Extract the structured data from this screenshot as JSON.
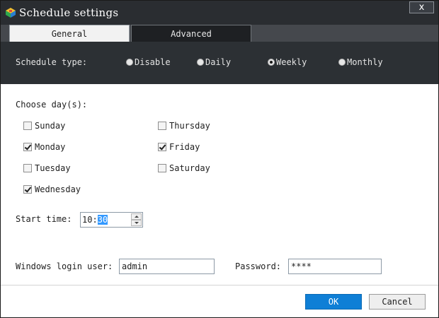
{
  "window": {
    "title": "Schedule settings",
    "close_label": "x"
  },
  "tabs": [
    {
      "label": "General",
      "active": true
    },
    {
      "label": "Advanced",
      "active": false
    }
  ],
  "schedule_type": {
    "label": "Schedule type:",
    "options": [
      {
        "label": "Disable",
        "selected": false
      },
      {
        "label": "Daily",
        "selected": false
      },
      {
        "label": "Weekly",
        "selected": true
      },
      {
        "label": "Monthly",
        "selected": false
      }
    ]
  },
  "days": {
    "label": "Choose day(s):",
    "items": [
      {
        "label": "Sunday",
        "checked": false
      },
      {
        "label": "Monday",
        "checked": true
      },
      {
        "label": "Tuesday",
        "checked": false
      },
      {
        "label": "Wednesday",
        "checked": true
      },
      {
        "label": "Thursday",
        "checked": false
      },
      {
        "label": "Friday",
        "checked": true
      },
      {
        "label": "Saturday",
        "checked": false
      }
    ]
  },
  "start_time": {
    "label": "Start time:",
    "hour": "10:",
    "minute": "30"
  },
  "login": {
    "user_label": "Windows login user:",
    "user_value": "admin",
    "password_label": "Password:",
    "password_value": "****"
  },
  "buttons": {
    "ok": "OK",
    "cancel": "Cancel"
  },
  "colors": {
    "title_bar": "#2a2d31",
    "type_bar": "#2c3034",
    "ok_button": "#0f7fd6",
    "selection": "#3399ff"
  }
}
